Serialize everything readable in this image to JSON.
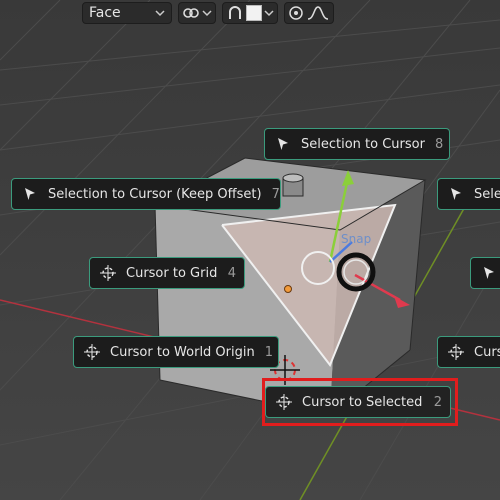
{
  "header": {
    "mode_select": "Face",
    "icons": [
      "link-icon",
      "chevron-down-icon",
      "magnet-icon",
      "square-swatch-icon",
      "proportional-edit-icon",
      "falloff-curve-icon"
    ]
  },
  "viewport": {
    "snap_label": "Snap",
    "colors": {
      "background": "#3d3d3d",
      "grid": "#4a4a4a",
      "x_axis": "#b3323e",
      "y_axis": "#7a9a2a",
      "cube": "#a8a8a8",
      "selected_face": "#c9b6b0",
      "pie_border": "#3b9b7d",
      "highlight": "#e11d1d"
    }
  },
  "pie_menu": {
    "items": [
      {
        "label": "Selection to Cursor",
        "shortcut": "8",
        "icon": "cursor-arrow-icon"
      },
      {
        "label": "Selection to Cursor (Keep Offset)",
        "shortcut": "7",
        "icon": "cursor-arrow-icon"
      },
      {
        "label": "Selec",
        "shortcut": "",
        "icon": "cursor-arrow-icon"
      },
      {
        "label": "Cursor to Grid",
        "shortcut": "4",
        "icon": "3d-cursor-icon"
      },
      {
        "label": "",
        "shortcut": "",
        "icon": "cursor-arrow-icon"
      },
      {
        "label": "Cursor to World Origin",
        "shortcut": "1",
        "icon": "3d-cursor-icon"
      },
      {
        "label": "Curs",
        "shortcut": "",
        "icon": "3d-cursor-icon"
      },
      {
        "label": "Cursor to Selected",
        "shortcut": "2",
        "icon": "3d-cursor-icon"
      }
    ]
  }
}
